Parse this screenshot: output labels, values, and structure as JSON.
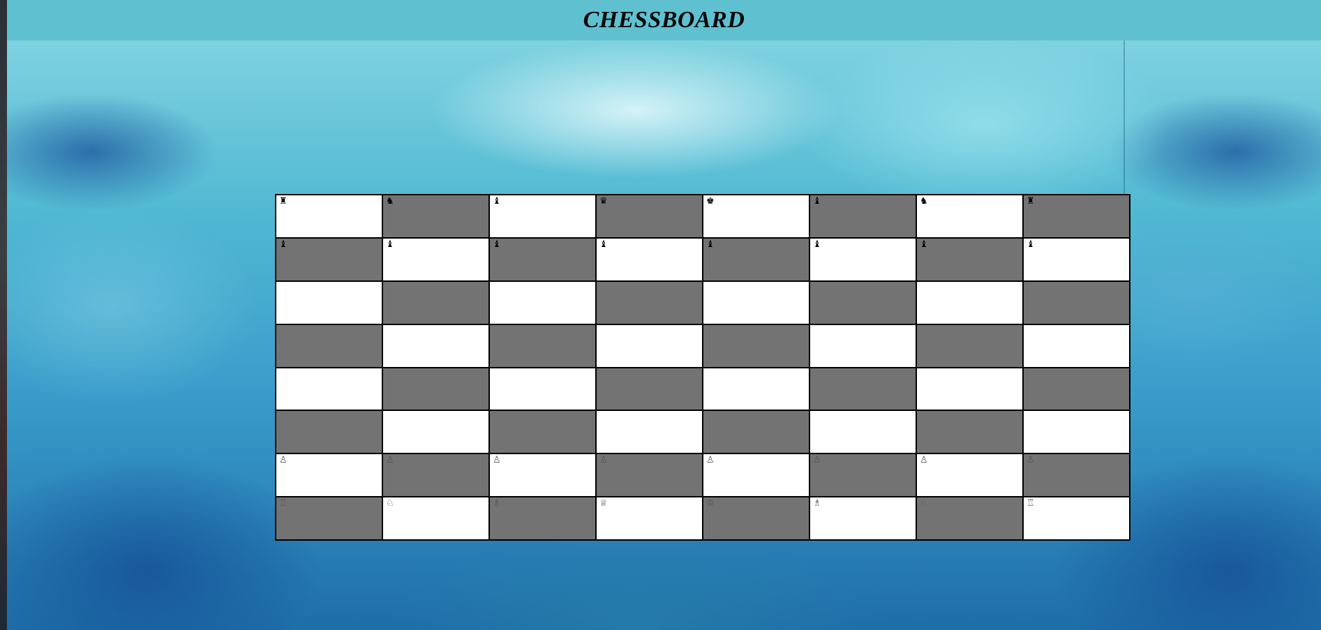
{
  "header": {
    "title": "CHESSBOARD"
  },
  "board": {
    "ranks": [
      [
        {
          "piece": "♜",
          "name": "black-rook",
          "color": "black"
        },
        {
          "piece": "♞",
          "name": "black-knight",
          "color": "black"
        },
        {
          "piece": "♝",
          "name": "black-bishop",
          "color": "black"
        },
        {
          "piece": "♛",
          "name": "black-queen",
          "color": "black"
        },
        {
          "piece": "♚",
          "name": "black-king",
          "color": "black"
        },
        {
          "piece": "♝",
          "name": "black-bishop",
          "color": "black"
        },
        {
          "piece": "♞",
          "name": "black-knight",
          "color": "black"
        },
        {
          "piece": "♜",
          "name": "black-rook",
          "color": "black"
        }
      ],
      [
        {
          "piece": "♝",
          "name": "black-bishop",
          "color": "black"
        },
        {
          "piece": "♝",
          "name": "black-bishop",
          "color": "black"
        },
        {
          "piece": "♝",
          "name": "black-bishop",
          "color": "black"
        },
        {
          "piece": "♝",
          "name": "black-bishop",
          "color": "black"
        },
        {
          "piece": "♝",
          "name": "black-bishop",
          "color": "black"
        },
        {
          "piece": "♝",
          "name": "black-bishop",
          "color": "black"
        },
        {
          "piece": "♝",
          "name": "black-bishop",
          "color": "black"
        },
        {
          "piece": "♝",
          "name": "black-bishop",
          "color": "black"
        }
      ],
      [
        null,
        null,
        null,
        null,
        null,
        null,
        null,
        null
      ],
      [
        null,
        null,
        null,
        null,
        null,
        null,
        null,
        null
      ],
      [
        null,
        null,
        null,
        null,
        null,
        null,
        null,
        null
      ],
      [
        null,
        null,
        null,
        null,
        null,
        null,
        null,
        null
      ],
      [
        {
          "piece": "♙",
          "name": "white-pawn",
          "color": "white"
        },
        {
          "piece": "♙",
          "name": "white-pawn",
          "color": "white"
        },
        {
          "piece": "♙",
          "name": "white-pawn",
          "color": "white"
        },
        {
          "piece": "♙",
          "name": "white-pawn",
          "color": "white"
        },
        {
          "piece": "♙",
          "name": "white-pawn",
          "color": "white"
        },
        {
          "piece": "♙",
          "name": "white-pawn",
          "color": "white"
        },
        {
          "piece": "♙",
          "name": "white-pawn",
          "color": "white"
        },
        {
          "piece": "♙",
          "name": "white-pawn",
          "color": "white"
        }
      ],
      [
        {
          "piece": "♖",
          "name": "white-rook",
          "color": "white"
        },
        {
          "piece": "♘",
          "name": "white-knight",
          "color": "white"
        },
        {
          "piece": "♗",
          "name": "white-bishop",
          "color": "white"
        },
        {
          "piece": "♕",
          "name": "white-queen",
          "color": "white"
        },
        {
          "piece": "♔",
          "name": "white-king",
          "color": "white"
        },
        {
          "piece": "♗",
          "name": "white-bishop",
          "color": "white"
        },
        {
          "piece": "♘",
          "name": "white-knight",
          "color": "white"
        },
        {
          "piece": "♖",
          "name": "white-rook",
          "color": "white"
        }
      ]
    ],
    "light_color": "#ffffff",
    "dark_color": "#737373"
  },
  "colors": {
    "header_bg": "#5fc0d0"
  }
}
